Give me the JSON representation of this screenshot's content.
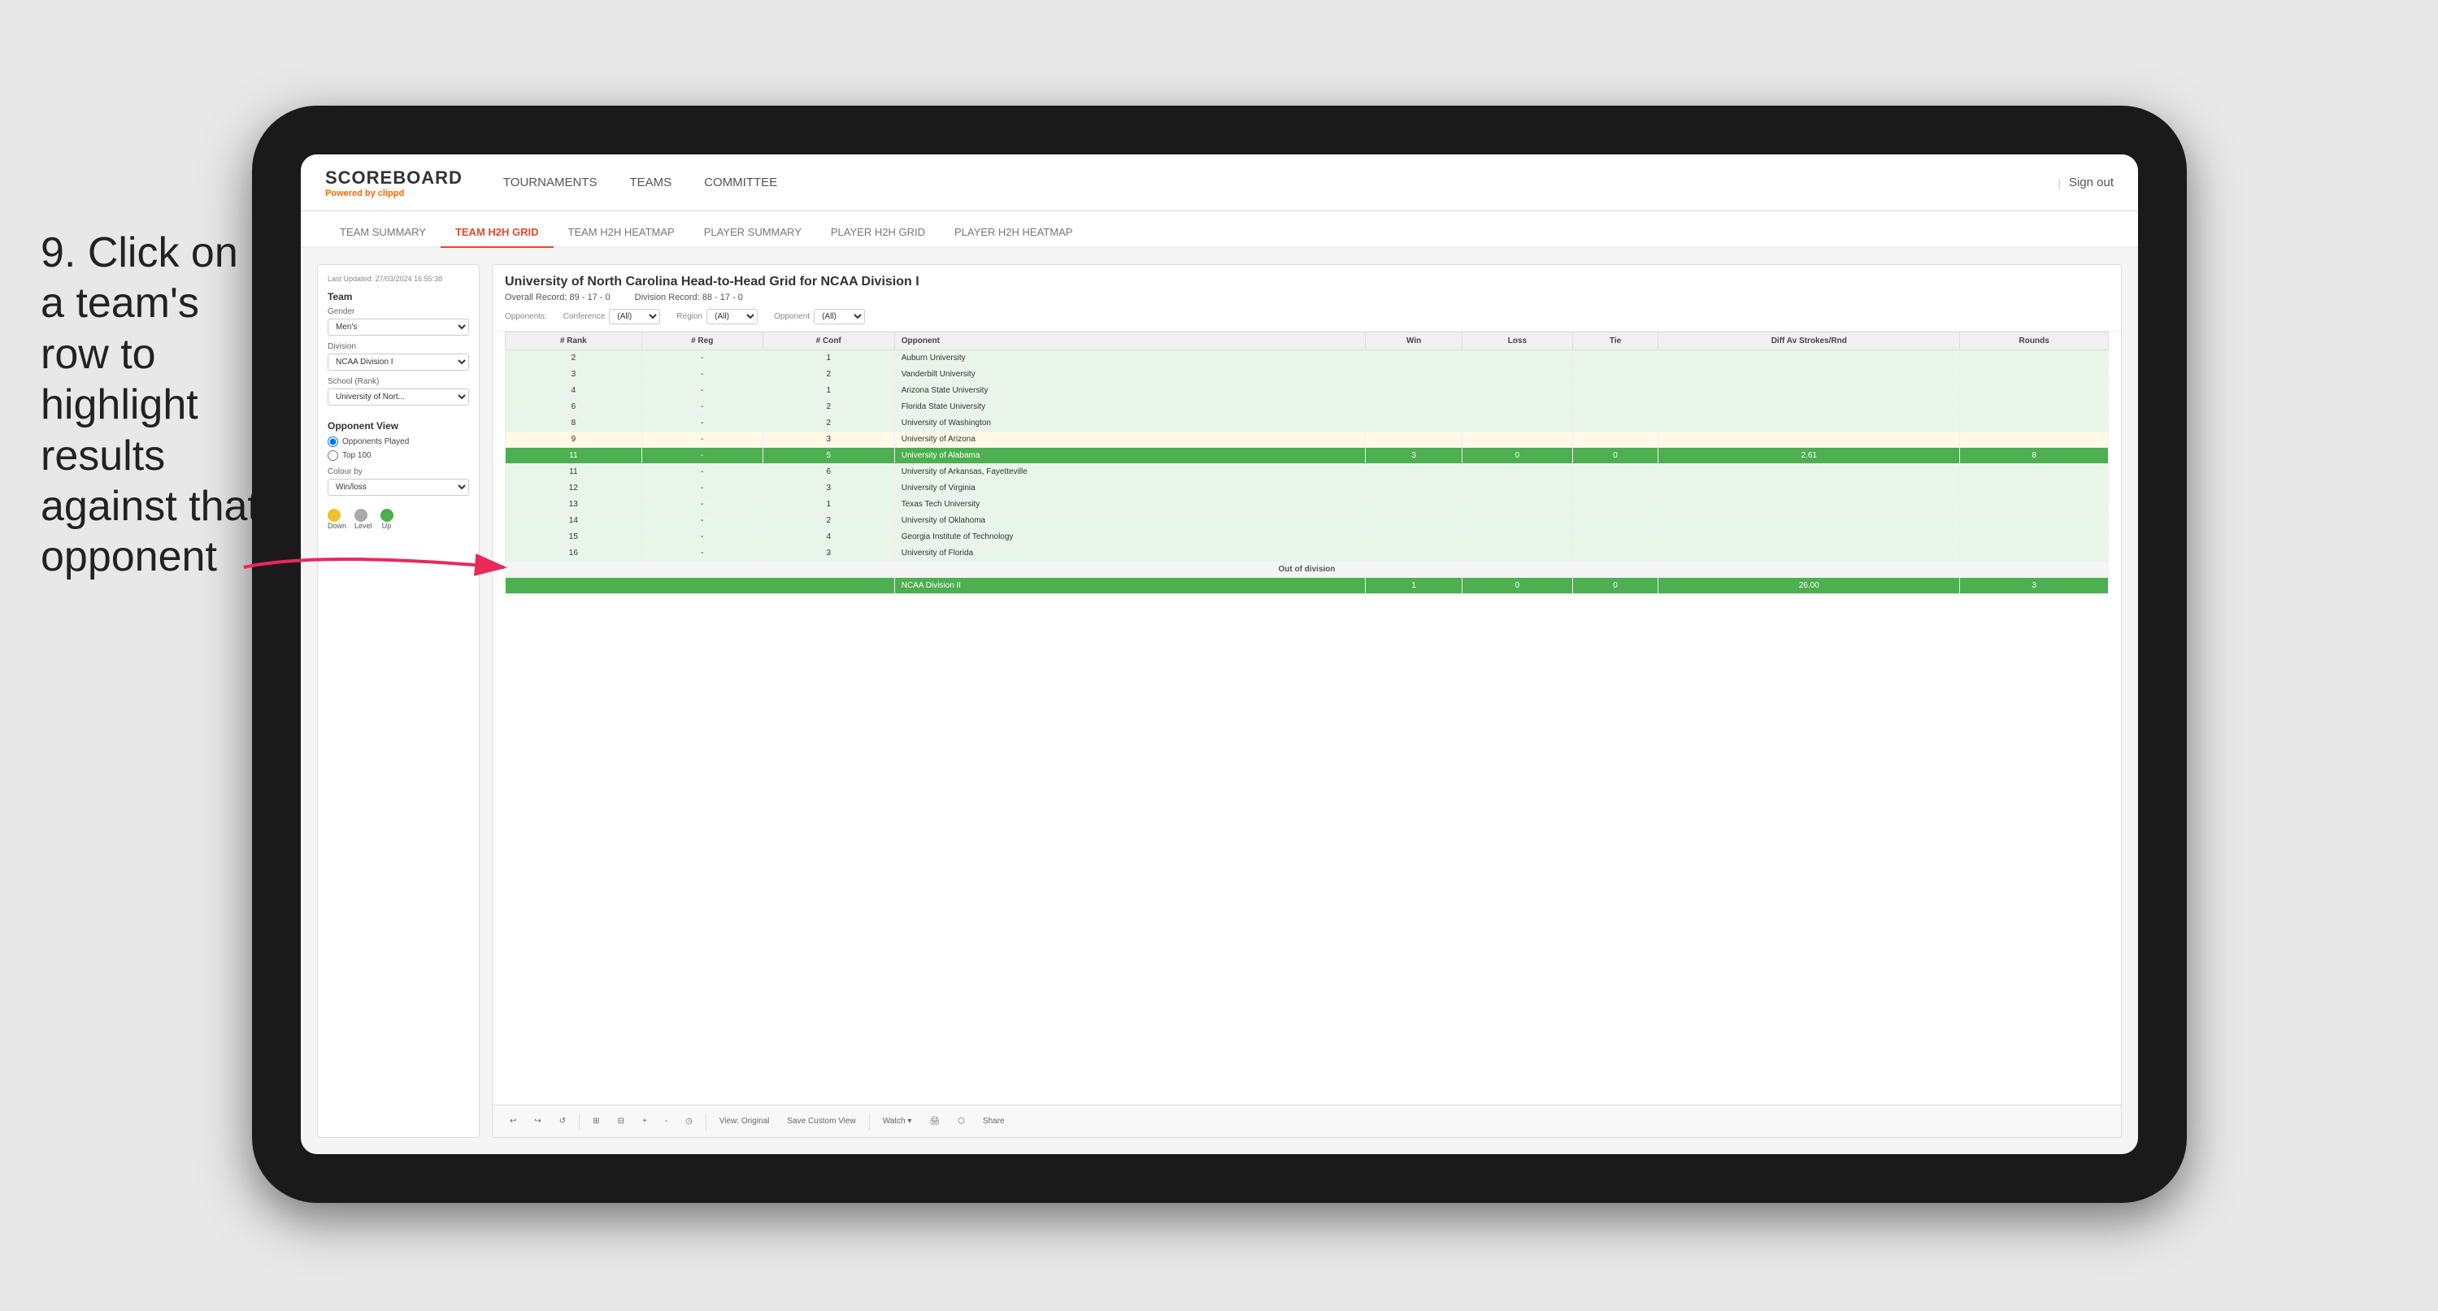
{
  "instruction": {
    "step": "9.",
    "text": "Click on a team's row to highlight results against that opponent"
  },
  "app": {
    "logo": {
      "title": "SCOREBOARD",
      "powered_by": "Powered by",
      "brand": "clippd"
    },
    "main_nav": [
      {
        "label": "TOURNAMENTS",
        "active": false
      },
      {
        "label": "TEAMS",
        "active": false
      },
      {
        "label": "COMMITTEE",
        "active": true
      }
    ],
    "sign_out": "Sign out"
  },
  "sub_nav": [
    {
      "label": "TEAM SUMMARY",
      "active": false
    },
    {
      "label": "TEAM H2H GRID",
      "active": true
    },
    {
      "label": "TEAM H2H HEATMAP",
      "active": false
    },
    {
      "label": "PLAYER SUMMARY",
      "active": false
    },
    {
      "label": "PLAYER H2H GRID",
      "active": false
    },
    {
      "label": "PLAYER H2H HEATMAP",
      "active": false
    }
  ],
  "left_panel": {
    "timestamp": "Last Updated: 27/03/2024 16:55:38",
    "team_label": "Team",
    "gender_label": "Gender",
    "gender_value": "Men's",
    "division_label": "Division",
    "division_value": "NCAA Division I",
    "school_rank_label": "School (Rank)",
    "school_rank_value": "University of Nort...",
    "opponent_view_label": "Opponent View",
    "opponent_view_options": [
      "Opponents Played",
      "Top 100"
    ],
    "opponent_view_selected": "Opponents Played",
    "colour_by_label": "Colour by",
    "colour_by_value": "Win/loss",
    "legend": [
      {
        "color": "#f0c030",
        "label": "Down"
      },
      {
        "color": "#aaaaaa",
        "label": "Level"
      },
      {
        "color": "#4caf50",
        "label": "Up"
      }
    ]
  },
  "grid": {
    "title": "University of North Carolina Head-to-Head Grid for NCAA Division I",
    "overall_record": "Overall Record: 89 - 17 - 0",
    "division_record": "Division Record: 88 - 17 - 0",
    "filters": {
      "opponents_label": "Opponents:",
      "conference_label": "Conference",
      "conference_value": "(All)",
      "region_label": "Region",
      "region_value": "(All)",
      "opponent_label": "Opponent",
      "opponent_value": "(All)"
    },
    "columns": [
      "# Rank",
      "# Reg",
      "# Conf",
      "Opponent",
      "Win",
      "Loss",
      "Tie",
      "Diff Av Strokes/Rnd",
      "Rounds"
    ],
    "rows": [
      {
        "rank": "2",
        "reg": "-",
        "conf": "1",
        "opponent": "Auburn University",
        "win": "",
        "loss": "",
        "tie": "",
        "diff": "",
        "rounds": "",
        "color": "light-green"
      },
      {
        "rank": "3",
        "reg": "-",
        "conf": "2",
        "opponent": "Vanderbilt University",
        "win": "",
        "loss": "",
        "tie": "",
        "diff": "",
        "rounds": "",
        "color": "light-green"
      },
      {
        "rank": "4",
        "reg": "-",
        "conf": "1",
        "opponent": "Arizona State University",
        "win": "",
        "loss": "",
        "tie": "",
        "diff": "",
        "rounds": "",
        "color": "light-green"
      },
      {
        "rank": "6",
        "reg": "-",
        "conf": "2",
        "opponent": "Florida State University",
        "win": "",
        "loss": "",
        "tie": "",
        "diff": "",
        "rounds": "",
        "color": "light-green"
      },
      {
        "rank": "8",
        "reg": "-",
        "conf": "2",
        "opponent": "University of Washington",
        "win": "",
        "loss": "",
        "tie": "",
        "diff": "",
        "rounds": "",
        "color": "light-green"
      },
      {
        "rank": "9",
        "reg": "-",
        "conf": "3",
        "opponent": "University of Arizona",
        "win": "",
        "loss": "",
        "tie": "",
        "diff": "",
        "rounds": "",
        "color": "light-yellow"
      },
      {
        "rank": "11",
        "reg": "-",
        "conf": "5",
        "opponent": "University of Alabama",
        "win": "3",
        "loss": "0",
        "tie": "0",
        "diff": "2.61",
        "rounds": "8",
        "color": "highlighted"
      },
      {
        "rank": "11",
        "reg": "-",
        "conf": "6",
        "opponent": "University of Arkansas, Fayetteville",
        "win": "",
        "loss": "",
        "tie": "",
        "diff": "",
        "rounds": "",
        "color": "light-green"
      },
      {
        "rank": "12",
        "reg": "-",
        "conf": "3",
        "opponent": "University of Virginia",
        "win": "",
        "loss": "",
        "tie": "",
        "diff": "",
        "rounds": "",
        "color": "light-green"
      },
      {
        "rank": "13",
        "reg": "-",
        "conf": "1",
        "opponent": "Texas Tech University",
        "win": "",
        "loss": "",
        "tie": "",
        "diff": "",
        "rounds": "",
        "color": "light-green"
      },
      {
        "rank": "14",
        "reg": "-",
        "conf": "2",
        "opponent": "University of Oklahoma",
        "win": "",
        "loss": "",
        "tie": "",
        "diff": "",
        "rounds": "",
        "color": "light-green"
      },
      {
        "rank": "15",
        "reg": "-",
        "conf": "4",
        "opponent": "Georgia Institute of Technology",
        "win": "",
        "loss": "",
        "tie": "",
        "diff": "",
        "rounds": "",
        "color": "light-green"
      },
      {
        "rank": "16",
        "reg": "-",
        "conf": "3",
        "opponent": "University of Florida",
        "win": "",
        "loss": "",
        "tie": "",
        "diff": "",
        "rounds": "",
        "color": "light-green"
      }
    ],
    "out_of_division_label": "Out of division",
    "out_of_division_row": {
      "name": "NCAA Division II",
      "win": "1",
      "loss": "0",
      "tie": "0",
      "diff": "26.00",
      "rounds": "3"
    }
  },
  "toolbar": {
    "buttons": [
      "←",
      "→",
      "↺",
      "⊞",
      "⊟",
      "+",
      "-",
      "◷",
      "View: Original",
      "Save Custom View",
      "Watch ▾",
      "🖨",
      "⬡",
      "Share"
    ]
  }
}
